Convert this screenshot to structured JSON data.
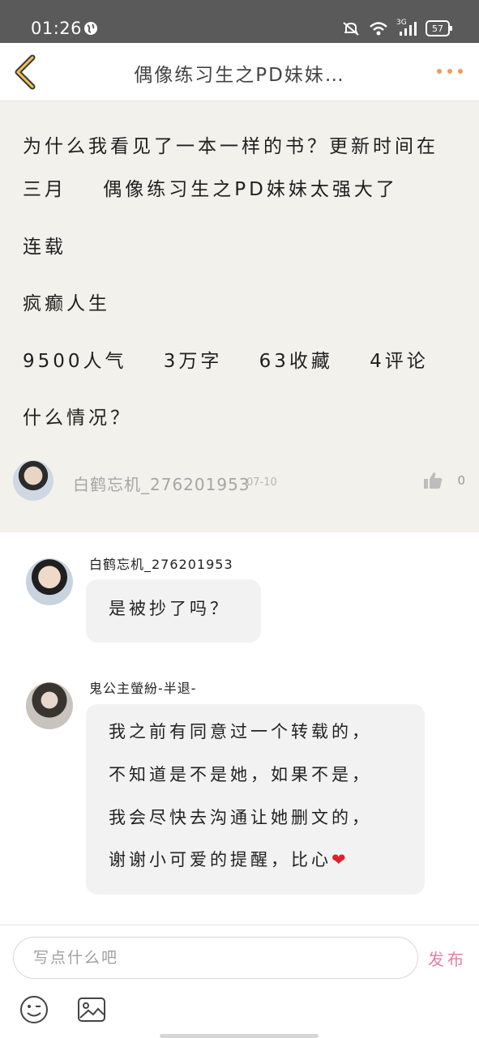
{
  "status_bar": {
    "time": "01:26",
    "network": "3G",
    "battery": "57"
  },
  "nav": {
    "title": "偶像练习生之PD妹妹…"
  },
  "post": {
    "lines": [
      "为什么我看见了一本一样的书？更新时间在",
      "三月    偶像练习生之PD妹妹太强大了",
      "连载",
      "疯癫人生",
      "9500人气    3万字    63收藏    4评论",
      "什么情况？"
    ],
    "author": "白鹤忘机_276201953",
    "date": "07-10",
    "like_count": "0"
  },
  "replies": [
    {
      "author": "白鹤忘机_276201953",
      "lines": [
        "是被抄了吗？"
      ]
    },
    {
      "author": "鬼公主螢紛-半退-",
      "lines": [
        "我之前有同意过一个转载的，",
        "不知道是不是她，如果不是，",
        "我会尽快去沟通让她删文的，",
        "谢谢小可爱的提醒，比心"
      ],
      "emoji": "❤"
    }
  ],
  "composer": {
    "placeholder": "写点什么吧",
    "publish_label": "发布"
  },
  "colors": {
    "post_background": "#f2f1ec",
    "accent_orange": "#f29a56",
    "publish_pink": "#e77fa0"
  }
}
